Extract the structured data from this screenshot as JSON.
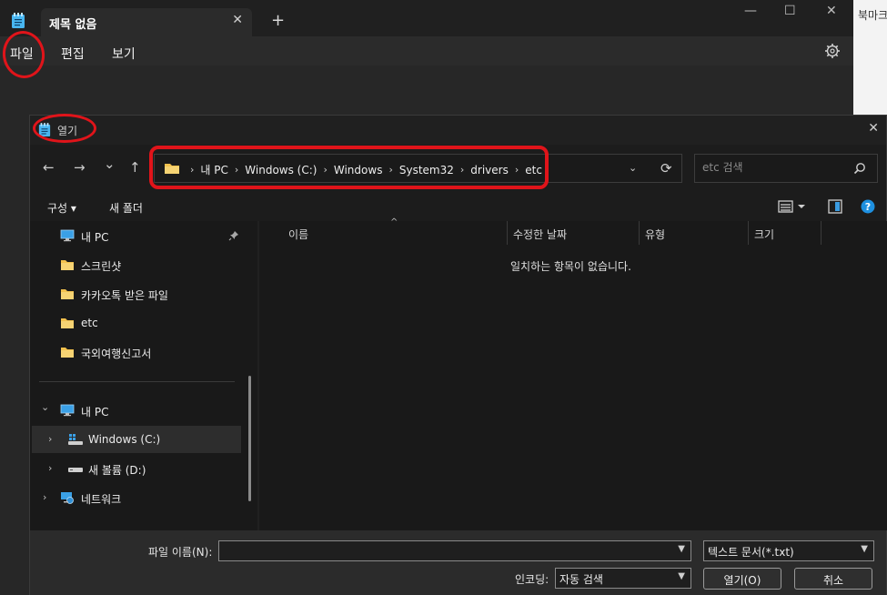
{
  "notepad": {
    "tab_title": "제목 없음",
    "tab_close": "✕",
    "new_tab": "+",
    "minimize": "—",
    "maximize": "☐",
    "close": "✕",
    "menu": {
      "file": "파일",
      "edit": "편집",
      "view": "보기"
    },
    "right_strip_text": "북마크"
  },
  "dialog": {
    "title": "열기",
    "close": "✕",
    "nav": {
      "back": "←",
      "forward": "→",
      "recent": "⌄",
      "up": "↑"
    },
    "breadcrumbs": [
      "내 PC",
      "Windows (C:)",
      "Windows",
      "System32",
      "drivers",
      "etc"
    ],
    "crumb_separator": "›",
    "address_dropdown": "⌄",
    "refresh": "⟳",
    "search_placeholder": "etc 검색",
    "commands": {
      "organize": "구성 ▾",
      "new_folder": "새 폴더"
    },
    "nav_pane": {
      "quick_access": [
        {
          "label": "내 PC",
          "icon": "monitor-icon",
          "pinned": true
        },
        {
          "label": "스크린샷",
          "icon": "folder-icon"
        },
        {
          "label": "카카오톡 받은 파일",
          "icon": "folder-icon"
        },
        {
          "label": "etc",
          "icon": "folder-icon"
        },
        {
          "label": "국외여행신고서",
          "icon": "folder-icon"
        }
      ],
      "tree": [
        {
          "label": "내 PC",
          "icon": "monitor-icon",
          "chevron": "⌄"
        },
        {
          "label": "Windows (C:)",
          "icon": "windows-drive-icon",
          "chevron": "›",
          "selected": true
        },
        {
          "label": "새 볼륨 (D:)",
          "icon": "drive-icon",
          "chevron": "›"
        },
        {
          "label": "네트워크",
          "icon": "network-icon",
          "chevron": "›"
        }
      ]
    },
    "columns": {
      "name": "이름",
      "date": "수정한 날짜",
      "type": "유형",
      "size": "크기"
    },
    "sort_indicator": "^",
    "empty_message": "일치하는 항목이 없습니다.",
    "bottom": {
      "filename_label": "파일 이름(N):",
      "filename_value": "",
      "filetype_value": "텍스트 문서(*.txt)",
      "encoding_label": "인코딩:",
      "encoding_value": "자동 검색",
      "open_button": "열기(O)",
      "cancel_button": "취소"
    }
  },
  "colors": {
    "accent": "#0067c0",
    "annotation": "#e0141a",
    "folder": "#f2c14e"
  }
}
